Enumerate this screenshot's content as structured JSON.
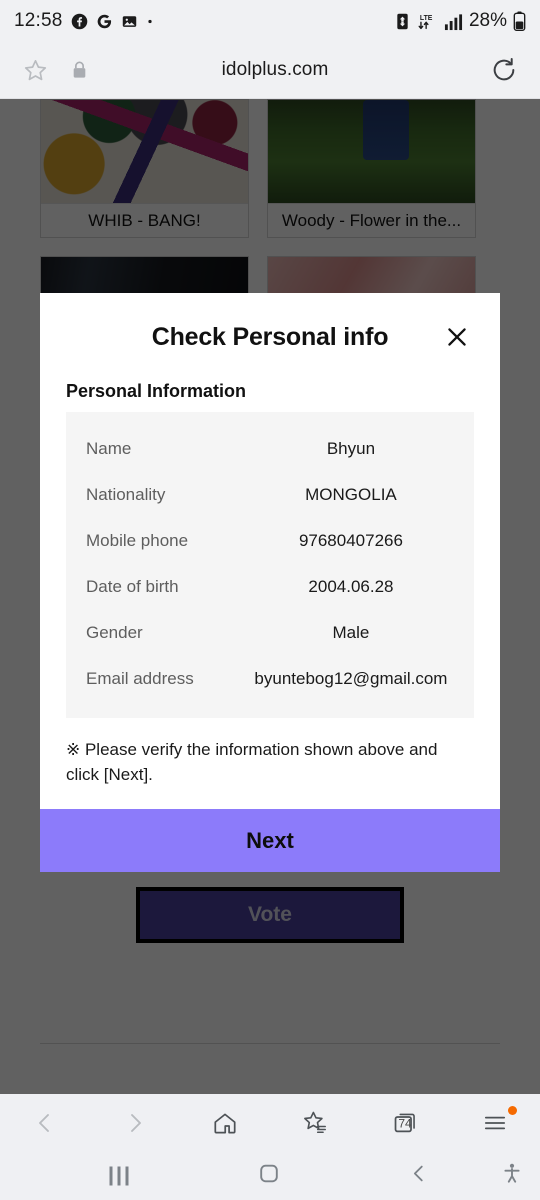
{
  "status_bar": {
    "clock": "12:58",
    "battery_percent": "28%",
    "network_type": "LTE",
    "left_icons": [
      "facebook-icon",
      "google-icon",
      "gallery-icon",
      "more-dot-icon"
    ],
    "right_icons": [
      "battery-saver-icon",
      "lte-data-icon",
      "signal-bars-icon",
      "battery-icon"
    ]
  },
  "browser": {
    "url": "idolplus.com",
    "bookmark_icon": "star-icon",
    "secure_icon": "lock-icon",
    "reload_icon": "reload-icon",
    "toolbar": {
      "back_label": "Back",
      "forward_label": "Forward",
      "home_label": "Home",
      "bookmarks_label": "Bookmarks",
      "tabs_count": "74",
      "menu_label": "Menu"
    }
  },
  "page": {
    "cards": [
      {
        "caption": "WHIB - BANG!",
        "thumb": "thumb-a"
      },
      {
        "caption": "Woody - Flower in the...",
        "thumb": "thumb-b"
      },
      {
        "caption": "",
        "thumb": "thumb-c"
      },
      {
        "caption": "",
        "thumb": "thumb-d"
      }
    ],
    "vote_button": "Vote"
  },
  "modal": {
    "title": "Check Personal info",
    "close_icon": "close-icon",
    "section_title": "Personal Information",
    "rows": [
      {
        "label": "Name",
        "value": "Bhyun"
      },
      {
        "label": "Nationality",
        "value": "MONGOLIA"
      },
      {
        "label": "Mobile phone",
        "value": "97680407266"
      },
      {
        "label": "Date of birth",
        "value": "2004.06.28"
      },
      {
        "label": "Gender",
        "value": "Male"
      },
      {
        "label": "Email address",
        "value": "byuntebog12@gmail.com"
      }
    ],
    "note": "※ Please verify the information shown above and click [Next].",
    "next_label": "Next"
  },
  "android_nav": {
    "recents_label": "Recents",
    "home_label": "Home",
    "back_label": "Back",
    "accessibility_label": "Accessibility"
  },
  "colors": {
    "accent_purple": "#8c7bfa",
    "vote_fill": "#4b3f9e",
    "menu_dot": "#f56a00",
    "chrome_bg": "#f0f1f3",
    "table_bg": "#f5f5f5"
  }
}
